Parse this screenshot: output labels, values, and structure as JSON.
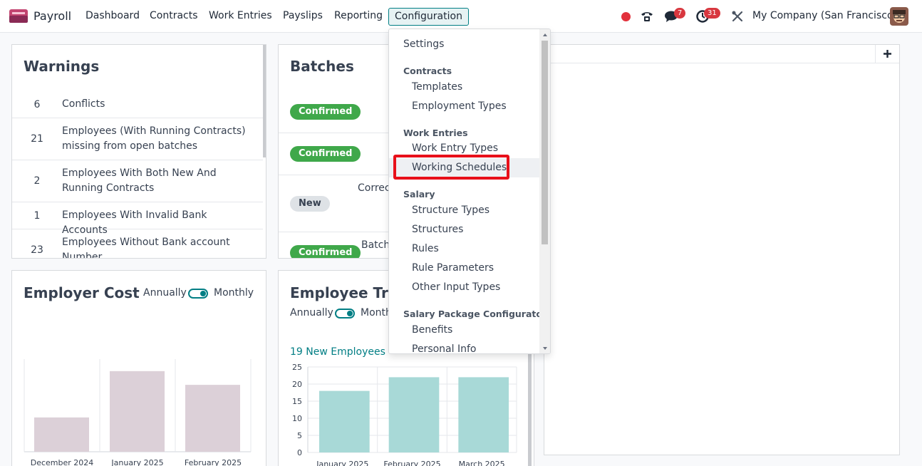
{
  "navbar": {
    "app_name": "Payroll",
    "menu": [
      "Dashboard",
      "Contracts",
      "Work Entries",
      "Payslips",
      "Reporting",
      "Configuration"
    ],
    "active_menu": "Configuration",
    "messages_count": "7",
    "activities_count": "31",
    "company": "My Company (San Francisco)"
  },
  "warnings": {
    "title": "Warnings",
    "rows": [
      {
        "count": "6",
        "label": "Conflicts"
      },
      {
        "count": "21",
        "label": "Employees (With Running Contracts) missing from open batches"
      },
      {
        "count": "2",
        "label": "Employees With Both New And Running Contracts"
      },
      {
        "count": "1",
        "label": "Employees With Invalid Bank Accounts"
      },
      {
        "count": "23",
        "label": "Employees Without Bank account Number"
      }
    ]
  },
  "batches": {
    "title": "Batches",
    "rows": [
      {
        "status": "Confirmed",
        "text": ""
      },
      {
        "status": "Confirmed",
        "text": ""
      },
      {
        "status": "New",
        "text": "Correc"
      },
      {
        "status": "Confirmed",
        "text": "Batch"
      }
    ]
  },
  "employer_cost": {
    "title": "Employer Cost",
    "toggle_left": "Annually",
    "toggle_right": "Monthly"
  },
  "employee_trend": {
    "title": "Employee Trer",
    "toggle_left": "Annually",
    "toggle_right": "Month",
    "new_employees": "19 New Employees"
  },
  "chart_data": [
    {
      "type": "bar",
      "categories": [
        "December 2024",
        "January 2025",
        "February 2025"
      ],
      "values": [
        10,
        23.5,
        19.5
      ],
      "ylim": [
        0,
        27
      ],
      "color": "#dcd0d8",
      "grid": false
    },
    {
      "type": "bar",
      "categories": [
        "January 2025",
        "February 2025",
        "March 2025"
      ],
      "values": [
        18,
        22,
        22
      ],
      "ylim": [
        0,
        25
      ],
      "yticks": [
        "0",
        "5",
        "10",
        "15",
        "20",
        "25"
      ],
      "color": "#a8d9d7",
      "grid": true
    }
  ],
  "dropdown": {
    "items": [
      {
        "kind": "item",
        "label": "Settings",
        "level": "top"
      },
      {
        "kind": "header",
        "label": "Contracts"
      },
      {
        "kind": "item",
        "label": "Templates",
        "level": "sub"
      },
      {
        "kind": "item",
        "label": "Employment Types",
        "level": "sub"
      },
      {
        "kind": "header",
        "label": "Work Entries"
      },
      {
        "kind": "item",
        "label": "Work Entry Types",
        "level": "sub"
      },
      {
        "kind": "item",
        "label": "Working Schedules",
        "level": "sub",
        "highlighted": true
      },
      {
        "kind": "header",
        "label": "Salary"
      },
      {
        "kind": "item",
        "label": "Structure Types",
        "level": "sub"
      },
      {
        "kind": "item",
        "label": "Structures",
        "level": "sub"
      },
      {
        "kind": "item",
        "label": "Rules",
        "level": "sub"
      },
      {
        "kind": "item",
        "label": "Rule Parameters",
        "level": "sub"
      },
      {
        "kind": "item",
        "label": "Other Input Types",
        "level": "sub"
      },
      {
        "kind": "header",
        "label": "Salary Package Configurator"
      },
      {
        "kind": "item",
        "label": "Benefits",
        "level": "sub"
      },
      {
        "kind": "item",
        "label": "Personal Info",
        "level": "sub"
      }
    ]
  },
  "colors": {
    "accent": "#017e84",
    "confirmed": "#3fa84a",
    "highlight": "#e8101a",
    "badge": "#d8373f"
  }
}
